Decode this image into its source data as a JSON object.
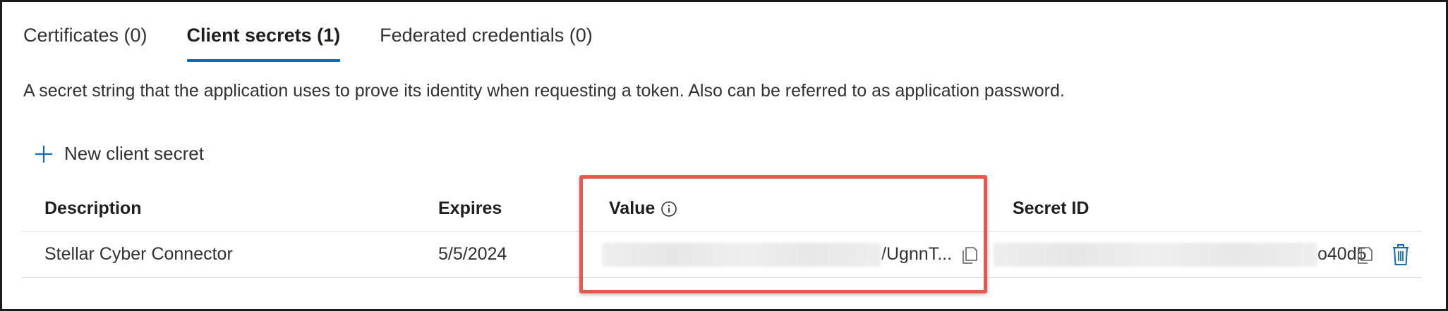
{
  "tabs": [
    {
      "label": "Certificates (0)",
      "active": false
    },
    {
      "label": "Client secrets (1)",
      "active": true
    },
    {
      "label": "Federated credentials (0)",
      "active": false
    }
  ],
  "description": "A secret string that the application uses to prove its identity when requesting a token. Also can be referred to as application password.",
  "actions": {
    "new_secret_label": "New client secret",
    "new_secret_icon": "plus-icon"
  },
  "table": {
    "columns": [
      "Description",
      "Expires",
      "Value",
      "Secret ID"
    ],
    "value_info_icon": "info-icon",
    "rows": [
      {
        "description": "Stellar Cyber Connector",
        "expires": "5/5/2024",
        "value_visible_suffix": "/UgnnT...",
        "secret_id_visible_suffix": "o40d5",
        "copy_icon": "copy-icon",
        "delete_icon": "trash-icon"
      }
    ]
  },
  "colors": {
    "accent": "#0f6cbd",
    "highlight": "#e8584f",
    "text": "#323130"
  }
}
